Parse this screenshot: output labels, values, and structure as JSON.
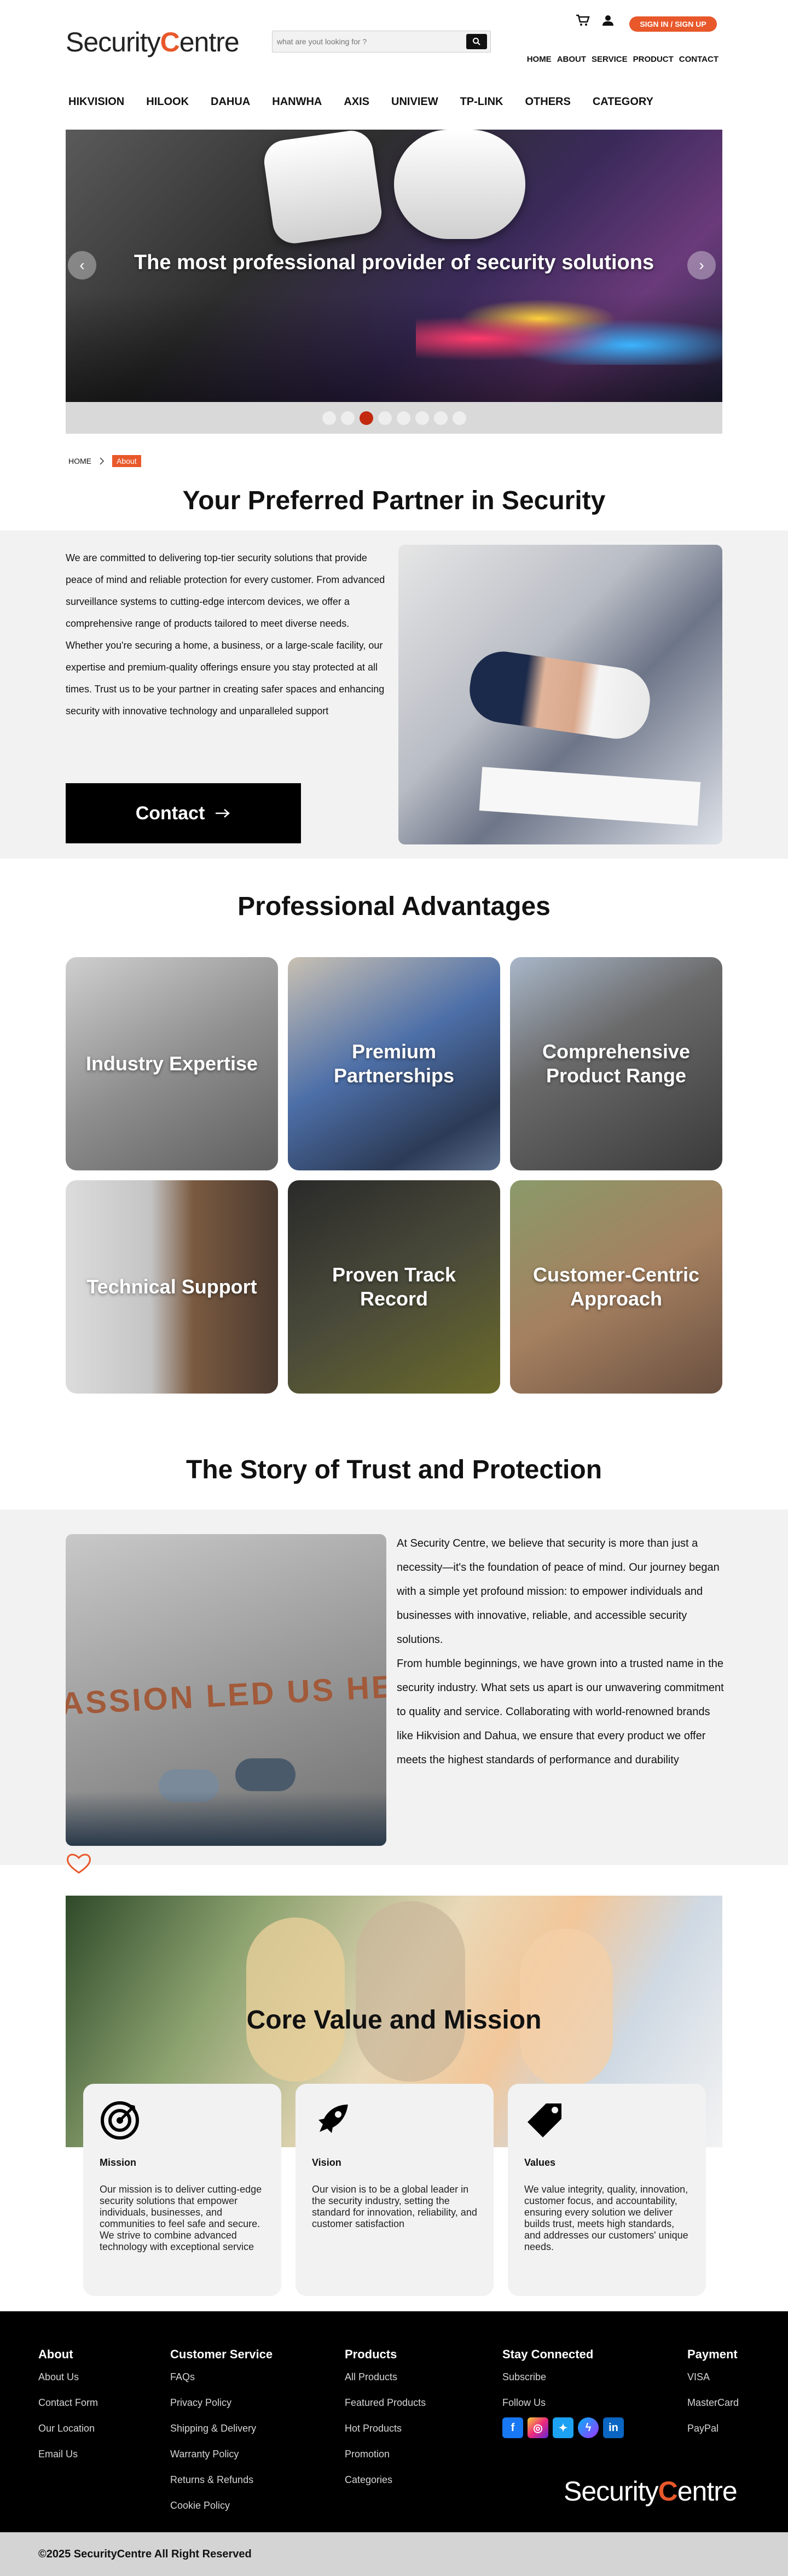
{
  "brand": {
    "logo_prefix": "Security",
    "logo_c": "C",
    "logo_suffix": "entre"
  },
  "search": {
    "placeholder": "what are yout looking for ?"
  },
  "signin": "SIGN IN / SIGN UP",
  "topnav": [
    "HOME",
    "ABOUT",
    "SERVICE",
    "PRODUCT",
    "CONTACT"
  ],
  "brandnav": [
    "HIKVISION",
    "HILOOK",
    "DAHUA",
    "HANWHA",
    "AXIS",
    "UNIVIEW",
    "TP-LINK",
    "OTHERS",
    "CATEGORY"
  ],
  "hero": {
    "title": "The most professional provider of security solutions",
    "slide_count": 8,
    "active_slide": 3
  },
  "breadcrumb": {
    "home": "HOME",
    "current": "About"
  },
  "partner": {
    "heading": "Your Preferred Partner in Security",
    "text": "We are committed to delivering top-tier security solutions that provide peace of mind and reliable protection for every customer. From advanced surveillance systems to cutting-edge intercom devices, we offer a comprehensive range of products tailored to meet diverse needs. Whether you're securing a home, a business, or a large-scale facility, our expertise and premium-quality offerings ensure you stay protected at all times. Trust us to be your partner in creating safer spaces and enhancing security with innovative technology and unparalleled support",
    "button": "Contact"
  },
  "advantages": {
    "heading": "Professional Advantages",
    "items": [
      {
        "label": "Industry Expertise"
      },
      {
        "label": "Premium Partnerships"
      },
      {
        "label": "Comprehensive Product Range"
      },
      {
        "label": "Technical Support"
      },
      {
        "label": "Proven Track Record"
      },
      {
        "label": "Customer-Centric Approach"
      }
    ]
  },
  "story": {
    "heading": "The Story of Trust and Protection",
    "image_text": "ASSION LED US HER",
    "paragraphs": [
      "At Security Centre, we believe that security is more than just a necessity—it's the foundation of peace of mind. Our journey began with a simple yet profound mission: to empower individuals and businesses with innovative, reliable, and accessible security solutions.",
      "From humble beginnings, we have grown into a trusted name in the security industry. What sets us apart is our unwavering commitment to quality and service. Collaborating with world-renowned brands like Hikvision and Dahua, we ensure that every product we offer meets the highest standards of performance and durability"
    ]
  },
  "core": {
    "heading": "Core Value and Mission",
    "cards": [
      {
        "icon": "target-icon",
        "title": "Mission",
        "text": "Our mission is to deliver cutting-edge security solutions that empower individuals, businesses, and communities to feel safe and secure. We strive to combine advanced technology with exceptional service"
      },
      {
        "icon": "rocket-icon",
        "title": "Vision",
        "text": "Our vision is to be a global leader in the security industry, setting the standard for innovation, reliability, and customer satisfaction"
      },
      {
        "icon": "tag-icon",
        "title": "Values",
        "text": "We value integrity, quality, innovation, customer focus, and accountability, ensuring every solution we deliver builds trust, meets high standards, and addresses our customers' unique needs."
      }
    ]
  },
  "footer": {
    "about": {
      "title": "About",
      "links": [
        "About Us",
        "Contact Form",
        "Our Location",
        "Email Us"
      ]
    },
    "service": {
      "title": "Customer Service",
      "links": [
        "FAQs",
        "Privacy Policy",
        "Shipping & Delivery",
        "Warranty Policy",
        "Returns & Refunds",
        "Cookie Policy"
      ]
    },
    "products": {
      "title": "Products",
      "links": [
        "All Products",
        "Featured Products",
        "Hot Products",
        "Promotion",
        "Categories"
      ]
    },
    "connect": {
      "title": "Stay Connected",
      "links": [
        "Subscribe",
        "Follow Us"
      ]
    },
    "payment": {
      "title": "Payment",
      "links": [
        "VISA",
        "MasterCard",
        "PayPal"
      ]
    },
    "social": [
      "facebook-icon",
      "instagram-icon",
      "twitter-icon",
      "messenger-icon",
      "linkedin-icon"
    ],
    "copyright": "©2025 SecurityCentre All Right Reserved"
  },
  "colors": {
    "accent": "#e8582b",
    "active_dot": "#c2290f",
    "footer_bg": "#000000"
  }
}
